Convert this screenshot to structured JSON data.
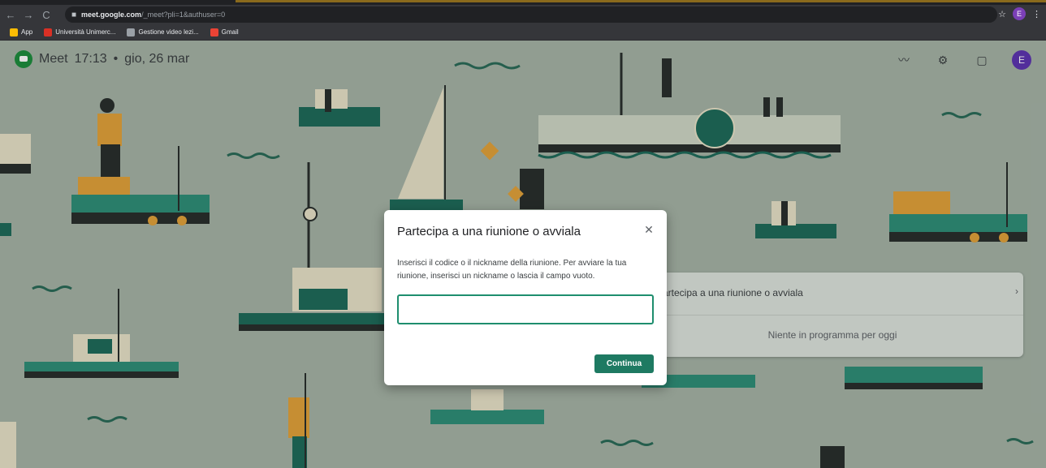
{
  "browser": {
    "url_domain": "meet.google.com",
    "url_path": "/_meet?pli=1&authuser=0",
    "profile_initial": "E",
    "bookmarks": [
      {
        "label": "App",
        "icon": "apps-grid-icon",
        "color": "#fbbc04"
      },
      {
        "label": "Università Unimerc...",
        "icon": "unimercatorum-icon",
        "color": "#d93025"
      },
      {
        "label": "Gestione video lezi...",
        "icon": "globe-icon",
        "color": "#9aa0a6"
      },
      {
        "label": "Gmail",
        "icon": "google-icon",
        "color": "#ea4335"
      }
    ]
  },
  "meet": {
    "app_name": "Meet",
    "time": "17:13",
    "separator": "•",
    "date": "gio, 26 mar",
    "avatar_initial": "E",
    "actions": [
      "activity-icon",
      "settings-icon",
      "feedback-icon"
    ]
  },
  "side_panel": {
    "join_label": "artecipa a una riunione o avviala",
    "empty_label": "Niente in programma per oggi"
  },
  "dialog": {
    "title": "Partecipa a una riunione o avviala",
    "close_glyph": "✕",
    "description": "Inserisci il codice o il nickname della riunione. Per avviare la tua riunione, inserisci un nickname o lascia il campo vuoto.",
    "input_value": "",
    "input_placeholder": "",
    "continue_label": "Continua"
  },
  "colors": {
    "accent": "#1e7a62",
    "background": "#a5b3a6",
    "avatar": "#5e35b1"
  }
}
